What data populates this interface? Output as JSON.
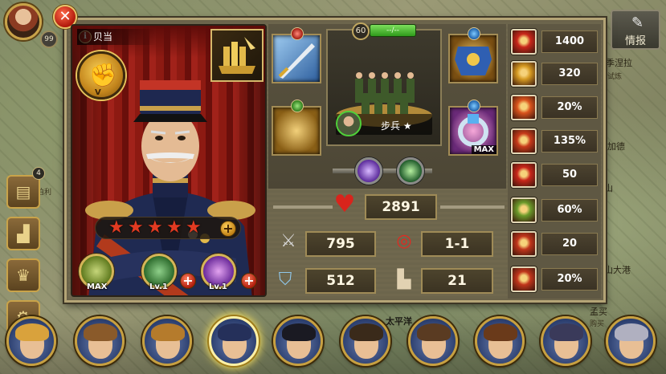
{
  "player": {
    "level": "99"
  },
  "map": {
    "labels": [
      "季涅拉",
      "试炼",
      "加德",
      "山",
      "山大港",
      "孟买",
      "购买",
      "太平洋",
      "伯利"
    ],
    "info_button": "情报"
  },
  "side_menu": {
    "badge": "4"
  },
  "hero": {
    "name": "贝当",
    "rank": "V",
    "stars": 5
  },
  "skills": [
    {
      "label": "MAX",
      "color": "#6b8f2a"
    },
    {
      "label": "Lv.1",
      "color": "#2f7a3a"
    },
    {
      "label": "Lv.1",
      "color": "#7c3ab0"
    }
  ],
  "troop": {
    "level": "60",
    "hp_text": "--/--",
    "name": "步兵 ★"
  },
  "equipment": {
    "bottom_right_tag": "MAX"
  },
  "stats": {
    "health": "2891",
    "attack": "795",
    "range": "1-1",
    "defense": "512",
    "speed": "21"
  },
  "attributes": [
    {
      "icon": "crosshair-icon",
      "value": "1400",
      "color": "#c8261a"
    },
    {
      "icon": "gold-hands-icon",
      "value": "320",
      "color": "#d59a22"
    },
    {
      "icon": "flame-burst-icon",
      "value": "20%",
      "color": "#d9531c"
    },
    {
      "icon": "fire-soldier-icon",
      "value": "135%",
      "color": "#c73a1a"
    },
    {
      "icon": "medical-cross-icon",
      "value": "50",
      "color": "#c8261a"
    },
    {
      "icon": "rank-chevron-icon",
      "value": "60%",
      "color": "#6a9a2a"
    },
    {
      "icon": "flame-figure-icon",
      "value": "20",
      "color": "#c0351b"
    },
    {
      "icon": "fire-aura-icon",
      "value": "20%",
      "color": "#c0351b"
    }
  ],
  "roster": [
    {
      "hair": "#d9a23c"
    },
    {
      "hair": "#8a5a2a"
    },
    {
      "hair": "#b57b2c"
    },
    {
      "hair": "#25305a"
    },
    {
      "hair": "#1a1a22"
    },
    {
      "hair": "#3a2a1a"
    },
    {
      "hair": "#5a3b22"
    },
    {
      "hair": "#6a3a1a"
    },
    {
      "hair": "#3a3a5a"
    },
    {
      "hair": "#b0b0c0"
    }
  ]
}
